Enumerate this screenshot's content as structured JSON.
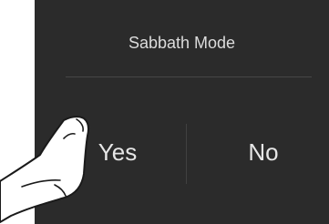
{
  "dialog": {
    "title": "Sabbath Mode",
    "yes_label": "Yes",
    "no_label": "No"
  },
  "overlay": {
    "icon": "pointing-finger-icon"
  },
  "colors": {
    "panel_bg": "#2b2b2b",
    "text": "#e6e6e6",
    "divider": "#474747"
  }
}
